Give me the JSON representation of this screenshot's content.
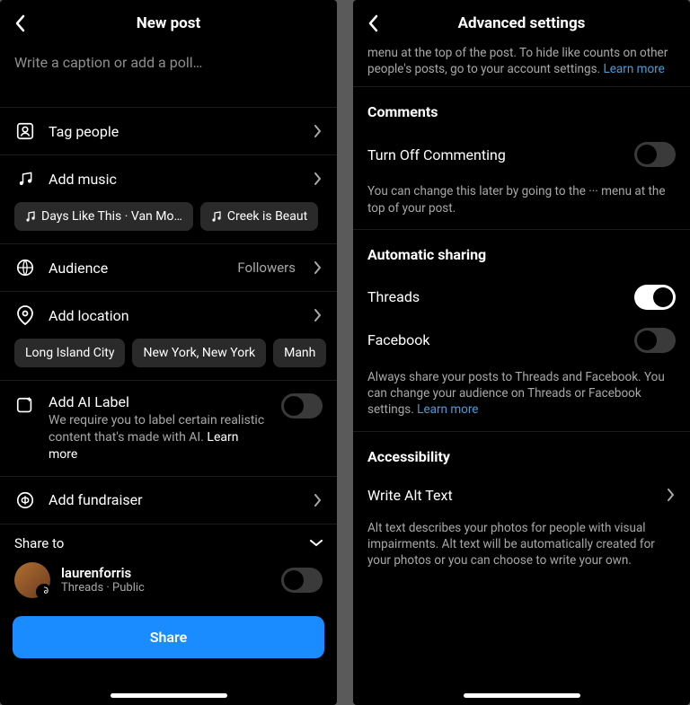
{
  "left": {
    "title": "New post",
    "caption_placeholder": "Write a caption or add a poll…",
    "rows": {
      "tag_people": "Tag people",
      "add_music": "Add music",
      "audience_label": "Audience",
      "audience_value": "Followers",
      "add_location": "Add location",
      "add_fundraiser": "Add fundraiser"
    },
    "music_chips": [
      "Days Like This · Van Mo…",
      "Creek is Beaut"
    ],
    "location_chips": [
      "Long Island City",
      "New York, New York",
      "Manh"
    ],
    "ai_label": {
      "title": "Add AI Label",
      "desc": "We require you to label certain realistic content that's made with AI.",
      "learn_more": "Learn more",
      "on": false
    },
    "share_to_label": "Share to",
    "account": {
      "name": "laurenforris",
      "sub": "Threads · Public",
      "toggle_on": false
    },
    "share_button": "Share"
  },
  "right": {
    "title": "Advanced settings",
    "top_paragraph_tail": "menu at the top of the post. To hide like counts on other people's posts, go to your account settings.",
    "top_learn_more": "Learn more",
    "sections": {
      "comments": {
        "heading": "Comments",
        "toggle_label": "Turn Off Commenting",
        "toggle_on": false,
        "helper": "You can change this later by going to the ··· menu at the top of your post."
      },
      "sharing": {
        "heading": "Automatic sharing",
        "threads_label": "Threads",
        "threads_on": true,
        "facebook_label": "Facebook",
        "facebook_on": false,
        "helper": "Always share your posts to Threads and Facebook. You can change your audience on Threads or Facebook settings.",
        "learn_more": "Learn more"
      },
      "accessibility": {
        "heading": "Accessibility",
        "alt_label": "Write Alt Text",
        "helper": "Alt text describes your photos for people with visual impairments. Alt text will be automatically created for your photos or you can choose to write your own."
      }
    }
  }
}
